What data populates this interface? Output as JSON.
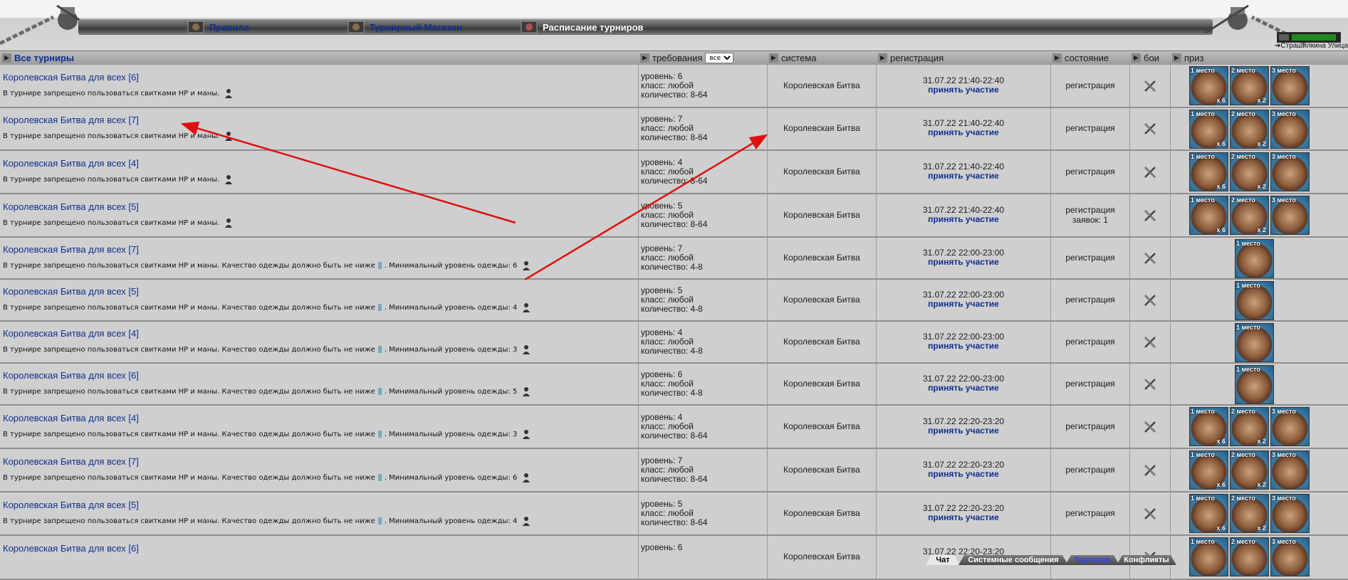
{
  "nav": {
    "items": [
      {
        "label": "Правила",
        "icon": "rules-icon",
        "active": false
      },
      {
        "label": "Турнирный Магазин",
        "icon": "shop-icon",
        "active": false
      },
      {
        "label": "Расписание турниров",
        "icon": "schedule-icon",
        "active": true
      }
    ],
    "location": "Страшилкина Улица"
  },
  "header": {
    "all": "Все турниры",
    "requirements": "требования",
    "filter_value": "все",
    "system": "система",
    "registration": "регистрация",
    "state": "состояние",
    "fights": "бои",
    "prize": "приз"
  },
  "rows": [
    {
      "name": "Королевская Битва для всех [6]",
      "desc": "В турнире запрещено пользоваться свитками HP и маны.",
      "desc2": "",
      "level": "уровень: 6",
      "class": "класс: любой",
      "count": "количество: 8-64",
      "system": "Королевская Битва",
      "time": "31.07.22 21:40-22:40",
      "join": "принять участие",
      "state": "регистрация",
      "state2": "",
      "prizes": [
        {
          "place": "1 место",
          "qty": "x 6"
        },
        {
          "place": "2 место",
          "qty": "x 2"
        },
        {
          "place": "3 место",
          "qty": ""
        }
      ]
    },
    {
      "name": "Королевская Битва для всех [7]",
      "desc": "В турнире запрещено пользоваться свитками HP и маны.",
      "desc2": "",
      "level": "уровень: 7",
      "class": "класс: любой",
      "count": "количество: 8-64",
      "system": "Королевская Битва",
      "time": "31.07.22 21:40-22:40",
      "join": "принять участие",
      "state": "регистрация",
      "state2": "",
      "prizes": [
        {
          "place": "1 место",
          "qty": "x 6"
        },
        {
          "place": "2 место",
          "qty": "x 2"
        },
        {
          "place": "3 место",
          "qty": ""
        }
      ]
    },
    {
      "name": "Королевская Битва для всех [4]",
      "desc": "В турнире запрещено пользоваться свитками HP и маны.",
      "desc2": "",
      "level": "уровень: 4",
      "class": "класс: любой",
      "count": "количество: 8-64",
      "system": "Королевская Битва",
      "time": "31.07.22 21:40-22:40",
      "join": "принять участие",
      "state": "регистрация",
      "state2": "",
      "prizes": [
        {
          "place": "1 место",
          "qty": "x 6"
        },
        {
          "place": "2 место",
          "qty": "x 2"
        },
        {
          "place": "3 место",
          "qty": ""
        }
      ]
    },
    {
      "name": "Королевская Битва для всех [5]",
      "desc": "В турнире запрещено пользоваться свитками HP и маны.",
      "desc2": "",
      "level": "уровень: 5",
      "class": "класс: любой",
      "count": "количество: 8-64",
      "system": "Королевская Битва",
      "time": "31.07.22 21:40-22:40",
      "join": "принять участие",
      "state": "регистрация",
      "state2": "заявок: 1",
      "prizes": [
        {
          "place": "1 место",
          "qty": "x 6"
        },
        {
          "place": "2 место",
          "qty": "x 2"
        },
        {
          "place": "3 место",
          "qty": ""
        }
      ]
    },
    {
      "name": "Королевская Битва для всех [7]",
      "desc": "В турнире запрещено пользоваться свитками HP и маны. Качество одежды должно быть не ниже",
      "desc2": ". Минимальный уровень одежды: 6",
      "level": "уровень: 7",
      "class": "класс: любой",
      "count": "количество: 4-8",
      "system": "Королевская Битва",
      "time": "31.07.22 22:00-23:00",
      "join": "принять участие",
      "state": "регистрация",
      "state2": "",
      "prizes": [
        {
          "place": "1 место",
          "qty": ""
        }
      ]
    },
    {
      "name": "Королевская Битва для всех [5]",
      "desc": "В турнире запрещено пользоваться свитками HP и маны. Качество одежды должно быть не ниже",
      "desc2": ". Минимальный уровень одежды: 4",
      "level": "уровень: 5",
      "class": "класс: любой",
      "count": "количество: 4-8",
      "system": "Королевская Битва",
      "time": "31.07.22 22:00-23:00",
      "join": "принять участие",
      "state": "регистрация",
      "state2": "",
      "prizes": [
        {
          "place": "1 место",
          "qty": ""
        }
      ]
    },
    {
      "name": "Королевская Битва для всех [4]",
      "desc": "В турнире запрещено пользоваться свитками HP и маны. Качество одежды должно быть не ниже",
      "desc2": ". Минимальный уровень одежды: 3",
      "level": "уровень: 4",
      "class": "класс: любой",
      "count": "количество: 4-8",
      "system": "Королевская Битва",
      "time": "31.07.22 22:00-23:00",
      "join": "принять участие",
      "state": "регистрация",
      "state2": "",
      "prizes": [
        {
          "place": "1 место",
          "qty": ""
        }
      ]
    },
    {
      "name": "Королевская Битва для всех [6]",
      "desc": "В турнире запрещено пользоваться свитками HP и маны. Качество одежды должно быть не ниже",
      "desc2": ". Минимальный уровень одежды: 5",
      "level": "уровень: 6",
      "class": "класс: любой",
      "count": "количество: 4-8",
      "system": "Королевская Битва",
      "time": "31.07.22 22:00-23:00",
      "join": "принять участие",
      "state": "регистрация",
      "state2": "",
      "prizes": [
        {
          "place": "1 место",
          "qty": ""
        }
      ]
    },
    {
      "name": "Королевская Битва для всех [4]",
      "desc": "В турнире запрещено пользоваться свитками HP и маны. Качество одежды должно быть не ниже",
      "desc2": ". Минимальный уровень одежды: 3",
      "level": "уровень: 4",
      "class": "класс: любой",
      "count": "количество: 8-64",
      "system": "Королевская Битва",
      "time": "31.07.22 22:20-23:20",
      "join": "принять участие",
      "state": "регистрация",
      "state2": "",
      "prizes": [
        {
          "place": "1 место",
          "qty": "x 6"
        },
        {
          "place": "2 место",
          "qty": "x 2"
        },
        {
          "place": "3 место",
          "qty": ""
        }
      ]
    },
    {
      "name": "Королевская Битва для всех [7]",
      "desc": "В турнире запрещено пользоваться свитками HP и маны. Качество одежды должно быть не ниже",
      "desc2": ". Минимальный уровень одежды: 6",
      "level": "уровень: 7",
      "class": "класс: любой",
      "count": "количество: 8-64",
      "system": "Королевская Битва",
      "time": "31.07.22 22:20-23:20",
      "join": "принять участие",
      "state": "регистрация",
      "state2": "",
      "prizes": [
        {
          "place": "1 место",
          "qty": "x 6"
        },
        {
          "place": "2 место",
          "qty": "x 2"
        },
        {
          "place": "3 место",
          "qty": ""
        }
      ]
    },
    {
      "name": "Королевская Битва для всех [5]",
      "desc": "В турнире запрещено пользоваться свитками HP и маны. Качество одежды должно быть не ниже",
      "desc2": ". Минимальный уровень одежды: 4",
      "level": "уровень: 5",
      "class": "класс: любой",
      "count": "количество: 8-64",
      "system": "Королевская Битва",
      "time": "31.07.22 22:20-23:20",
      "join": "принять участие",
      "state": "регистрация",
      "state2": "",
      "prizes": [
        {
          "place": "1 место",
          "qty": "x 6"
        },
        {
          "place": "2 место",
          "qty": "x 2"
        },
        {
          "place": "3 место",
          "qty": ""
        }
      ]
    },
    {
      "name": "Королевская Битва для всех [6]",
      "desc": "",
      "desc2": "",
      "level": "уровень: 6",
      "class": "",
      "count": "",
      "system": "Королевская Битва",
      "time": "31.07.22 22:20-23:20",
      "join": "",
      "state": "",
      "state2": "",
      "prizes": [
        {
          "place": "1 место",
          "qty": ""
        },
        {
          "place": "2 место",
          "qty": ""
        },
        {
          "place": "3 место",
          "qty": ""
        }
      ]
    }
  ],
  "bottom_tabs": [
    {
      "label": "Чат",
      "active": true
    },
    {
      "label": "Системные сообщения",
      "active": false
    },
    {
      "label": "Торговля",
      "active": false,
      "link": true
    },
    {
      "label": "Конфликты",
      "active": false
    }
  ],
  "colors": {
    "link": "#0f2f8f",
    "annotation_arrow": "#e01010"
  }
}
